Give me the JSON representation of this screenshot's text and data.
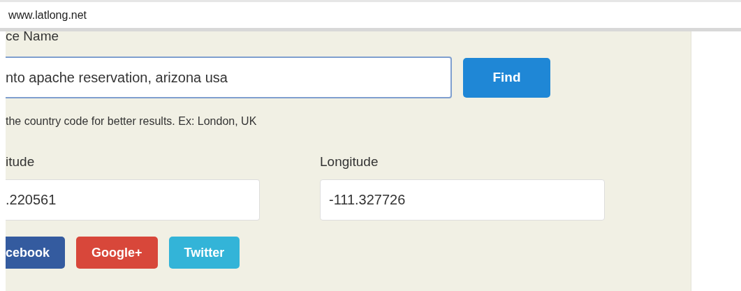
{
  "address_bar": {
    "url": "www.latlong.net"
  },
  "place": {
    "label": "ce Name",
    "value": "nto apache reservation, arizona usa",
    "focused": true,
    "button": "Find",
    "hint": "the country code for better results. Ex: London, UK"
  },
  "coordinates": [
    {
      "label": "itude",
      "value": ".220561"
    },
    {
      "label": "Longitude",
      "value": "-111.327726"
    }
  ],
  "share_buttons": [
    {
      "label": "cebook",
      "color": "#345b9f"
    },
    {
      "label": "Google+",
      "color": "#d8473a"
    },
    {
      "label": "Twitter",
      "color": "#33b4d8"
    }
  ]
}
